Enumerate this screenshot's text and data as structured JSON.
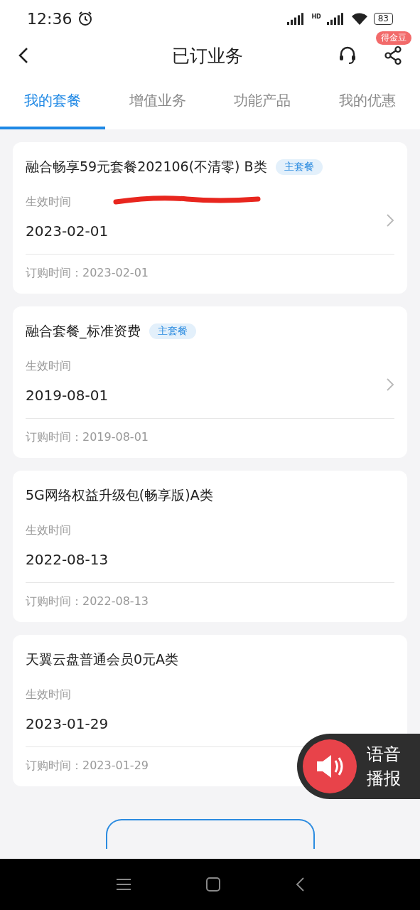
{
  "status_bar": {
    "time": "12:36",
    "battery": "83",
    "network_badge": "HD"
  },
  "header": {
    "title": "已订业务",
    "badge": "得金豆"
  },
  "tabs": [
    {
      "label": "我的套餐",
      "selected": true
    },
    {
      "label": "增值业务",
      "selected": false
    },
    {
      "label": "功能产品",
      "selected": false
    },
    {
      "label": "我的优惠",
      "selected": false
    }
  ],
  "cards": [
    {
      "title": "融合畅享59元套餐202106(不清零) B类",
      "tag": "主套餐",
      "effective_label": "生效时间",
      "effective_date": "2023-02-01",
      "order_time": "订购时间：2023-02-01",
      "chevron": true,
      "scribbled": true
    },
    {
      "title": "融合套餐_标准资费",
      "tag": "主套餐",
      "effective_label": "生效时间",
      "effective_date": "2019-08-01",
      "order_time": "订购时间：2019-08-01",
      "chevron": true,
      "scribbled": false
    },
    {
      "title": "5G网络权益升级包(畅享版)A类",
      "effective_label": "生效时间",
      "effective_date": "2022-08-13",
      "order_time": "订购时间：2022-08-13",
      "chevron": false,
      "scribbled": false
    },
    {
      "title": "天翼云盘普通会员0元A类",
      "effective_label": "生效时间",
      "effective_date": "2023-01-29",
      "order_time": "订购时间：2023-01-29",
      "chevron": false,
      "scribbled": false
    }
  ],
  "voice_button": {
    "lines": [
      "语音",
      "播报"
    ]
  }
}
